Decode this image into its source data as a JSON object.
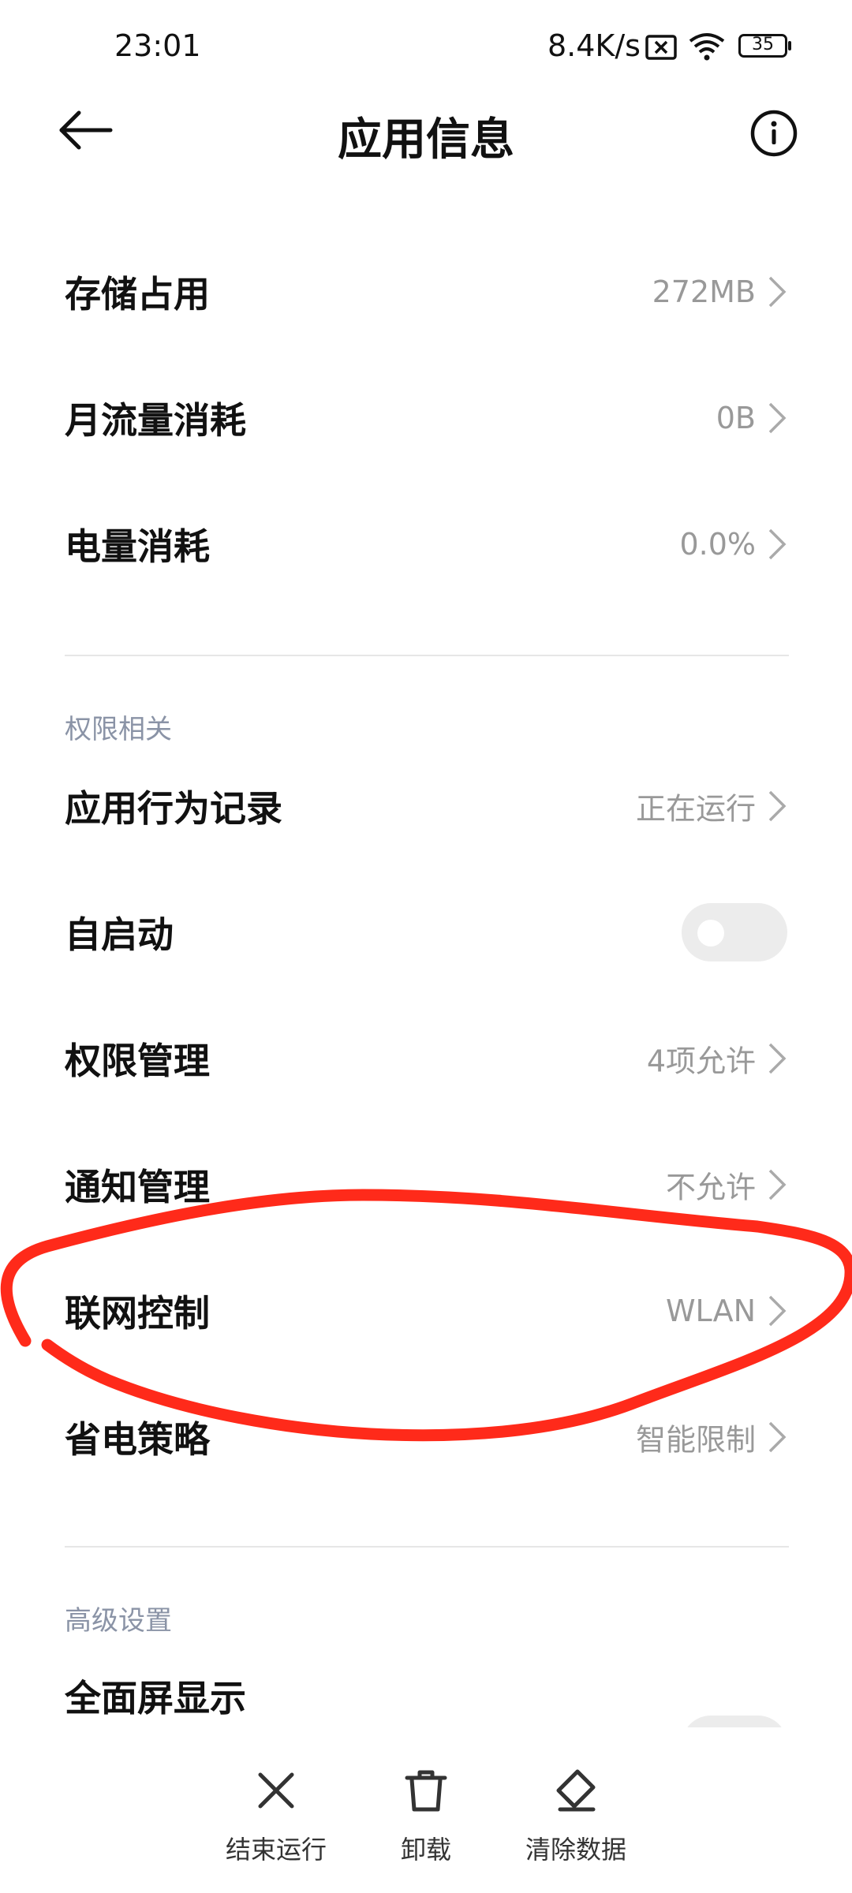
{
  "status_bar": {
    "time": "23:01",
    "net_speed": "8.4K/s",
    "battery": "35",
    "icons": [
      "no-sim-icon",
      "wifi-icon",
      "battery-icon"
    ]
  },
  "header": {
    "title": "应用信息",
    "back_icon": "back-arrow-icon",
    "info_icon": "info-icon"
  },
  "usage": [
    {
      "label": "存储占用",
      "value": "272MB"
    },
    {
      "label": "月流量消耗",
      "value": "0B"
    },
    {
      "label": "电量消耗",
      "value": "0.0%"
    }
  ],
  "permissions": {
    "header": "权限相关",
    "items": [
      {
        "label": "应用行为记录",
        "value": "正在运行"
      },
      {
        "label": "自启动",
        "toggle": false
      },
      {
        "label": "权限管理",
        "value": "4项允许"
      },
      {
        "label": "通知管理",
        "value": "不允许"
      },
      {
        "label": "联网控制",
        "value": "WLAN"
      },
      {
        "label": "省电策略",
        "value": "智能限制"
      }
    ]
  },
  "advanced": {
    "header": "高级设置",
    "items": [
      {
        "label": "全面屏显示",
        "toggle": false
      }
    ]
  },
  "bottom_actions": [
    {
      "label": "结束运行",
      "icon": "close-icon"
    },
    {
      "label": "卸载",
      "icon": "trash-icon"
    },
    {
      "label": "清除数据",
      "icon": "eraser-icon"
    }
  ],
  "colors": {
    "annotation": "#ff2a1a",
    "value_text": "#999999",
    "section_header": "#8a93a6"
  }
}
